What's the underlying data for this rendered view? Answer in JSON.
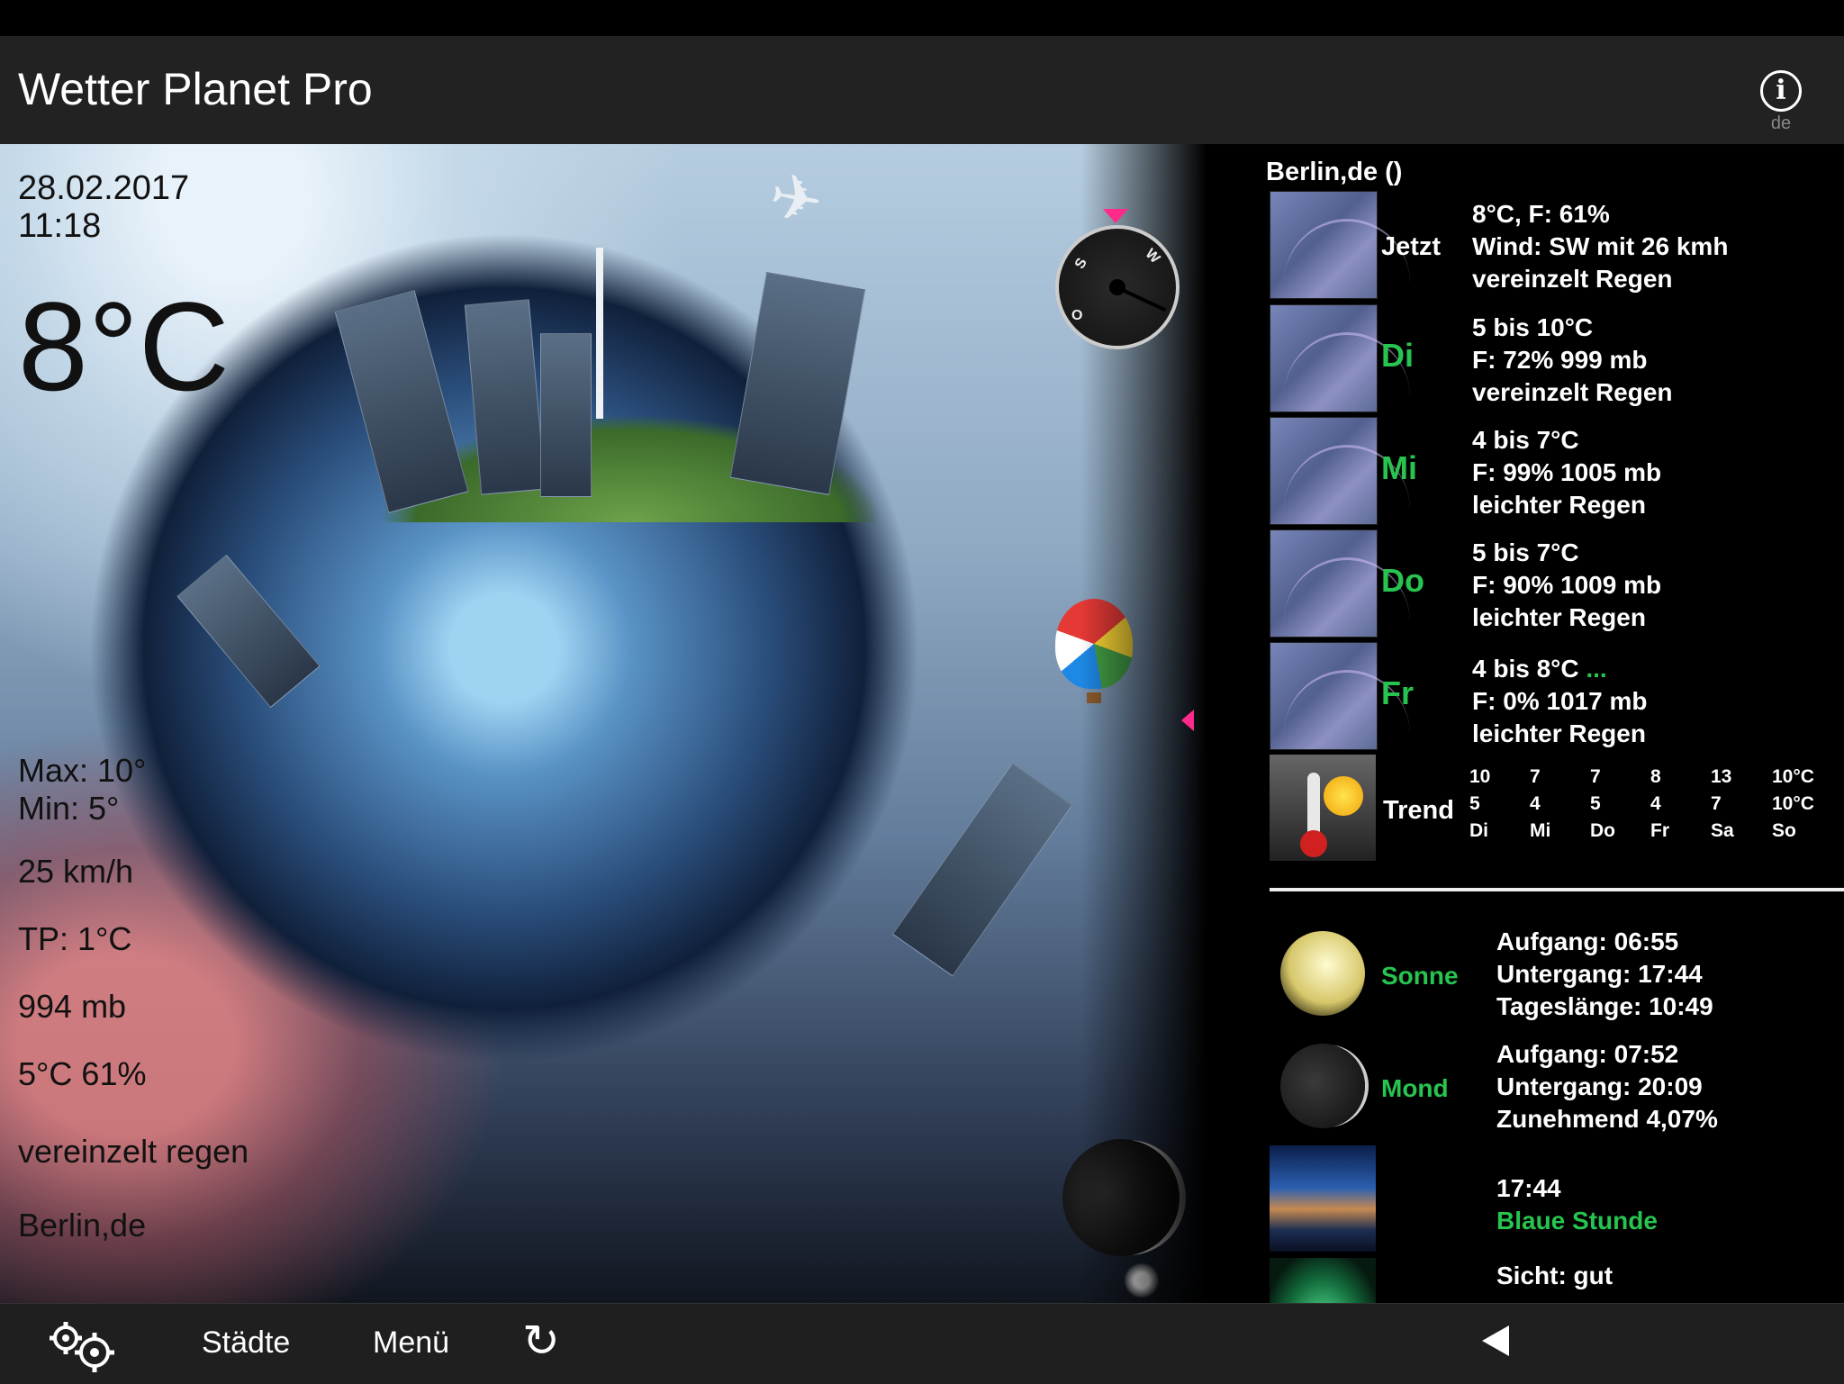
{
  "app": {
    "title": "Wetter Planet Pro",
    "lang": "de"
  },
  "overlay": {
    "date": "28.02.2017",
    "time": "11:18",
    "temp": "8°C",
    "max": "Max: 10°",
    "min": "Min: 5°",
    "wind": "25 km/h",
    "dewpoint": "TP: 1°C",
    "pressure": "994 mb",
    "humidity": "5°C 61%",
    "condition": "vereinzelt regen",
    "location": "Berlin,de"
  },
  "compass": {
    "labels": [
      "S",
      "W",
      "O"
    ]
  },
  "panel": {
    "location": "Berlin,de ()",
    "now": {
      "label": "Jetzt",
      "line1": "8°C, F: 61%",
      "line2": "Wind: SW mit 26 kmh",
      "line3": "vereinzelt Regen"
    },
    "forecast": [
      {
        "day": "Di",
        "line1": "5 bis 10°C",
        "line2": "F: 72% 999 mb",
        "line3": "vereinzelt Regen"
      },
      {
        "day": "Mi",
        "line1": "4 bis 7°C",
        "line2": "F: 99% 1005 mb",
        "line3": "leichter Regen"
      },
      {
        "day": "Do",
        "line1": "5 bis 7°C",
        "line2": "F: 90% 1009 mb",
        "line3": "leichter Regen"
      },
      {
        "day": "Fr",
        "line1": "4 bis 8°C",
        "more": "...",
        "line2": "F: 0% 1017 mb",
        "line3": "leichter Regen"
      }
    ],
    "trend": {
      "label": "Trend",
      "columns": [
        {
          "hi": "10",
          "lo": "5",
          "day": "Di"
        },
        {
          "hi": "7",
          "lo": "4",
          "day": "Mi"
        },
        {
          "hi": "7",
          "lo": "5",
          "day": "Do"
        },
        {
          "hi": "8",
          "lo": "4",
          "day": "Fr"
        },
        {
          "hi": "13",
          "lo": "7",
          "day": "Sa"
        },
        {
          "hi": "10°C",
          "lo": "10°C",
          "day": "So"
        }
      ]
    },
    "sun": {
      "label": "Sonne",
      "rise": "Aufgang: 06:55",
      "set": "Untergang: 17:44",
      "length": "Tageslänge: 10:49"
    },
    "moon": {
      "label": "Mond",
      "rise": "Aufgang: 07:52",
      "set": "Untergang: 20:09",
      "phase": "Zunehmend 4,07%"
    },
    "blue_hour": {
      "time": "17:44",
      "label": "Blaue Stunde"
    },
    "visibility": {
      "text": "Sicht: gut"
    }
  },
  "bottombar": {
    "cities": "Städte",
    "menu": "Menü"
  }
}
